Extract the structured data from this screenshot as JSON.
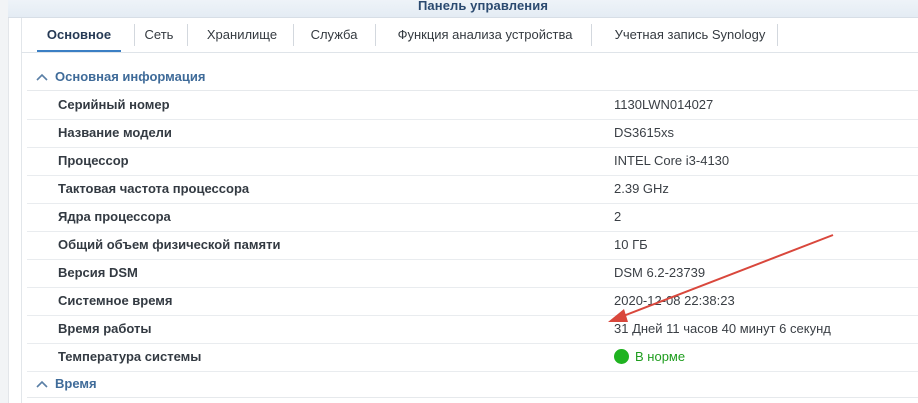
{
  "header": {
    "title": "Панель управления"
  },
  "tabs": [
    {
      "label": "Основное",
      "active": true
    },
    {
      "label": "Сеть",
      "active": false
    },
    {
      "label": "Хранилище",
      "active": false
    },
    {
      "label": "Служба",
      "active": false
    },
    {
      "label": "Функция анализа устройства",
      "active": false
    },
    {
      "label": "Учетная запись Synology",
      "active": false
    }
  ],
  "sections": {
    "basic_info": {
      "title": "Основная информация",
      "expanded": true,
      "rows": [
        {
          "label": "Серийный номер",
          "value": "1130LWN014027"
        },
        {
          "label": "Название модели",
          "value": "DS3615xs"
        },
        {
          "label": "Процессор",
          "value": "INTEL Core i3-4130"
        },
        {
          "label": "Тактовая частота процессора",
          "value": "2.39 GHz"
        },
        {
          "label": "Ядра процессора",
          "value": "2"
        },
        {
          "label": "Общий объем физической памяти",
          "value": "10 ГБ"
        },
        {
          "label": "Версия DSM",
          "value": "DSM 6.2-23739"
        },
        {
          "label": "Системное время",
          "value": "2020-12-08 22:38:23"
        },
        {
          "label": "Время работы",
          "value": "31 Дней 11 часов 40 минут 6 секунд"
        },
        {
          "label": "Температура системы",
          "value": "В норме",
          "status_color": "#1fb320"
        }
      ]
    },
    "time": {
      "title": "Время",
      "expanded": true
    }
  },
  "annotation": {
    "arrow_color": "#d9473c",
    "icon": "red-arrow"
  },
  "colors": {
    "accent": "#3b7fc4",
    "section_title": "#3f6b99",
    "status_ok": "#1fb320"
  }
}
